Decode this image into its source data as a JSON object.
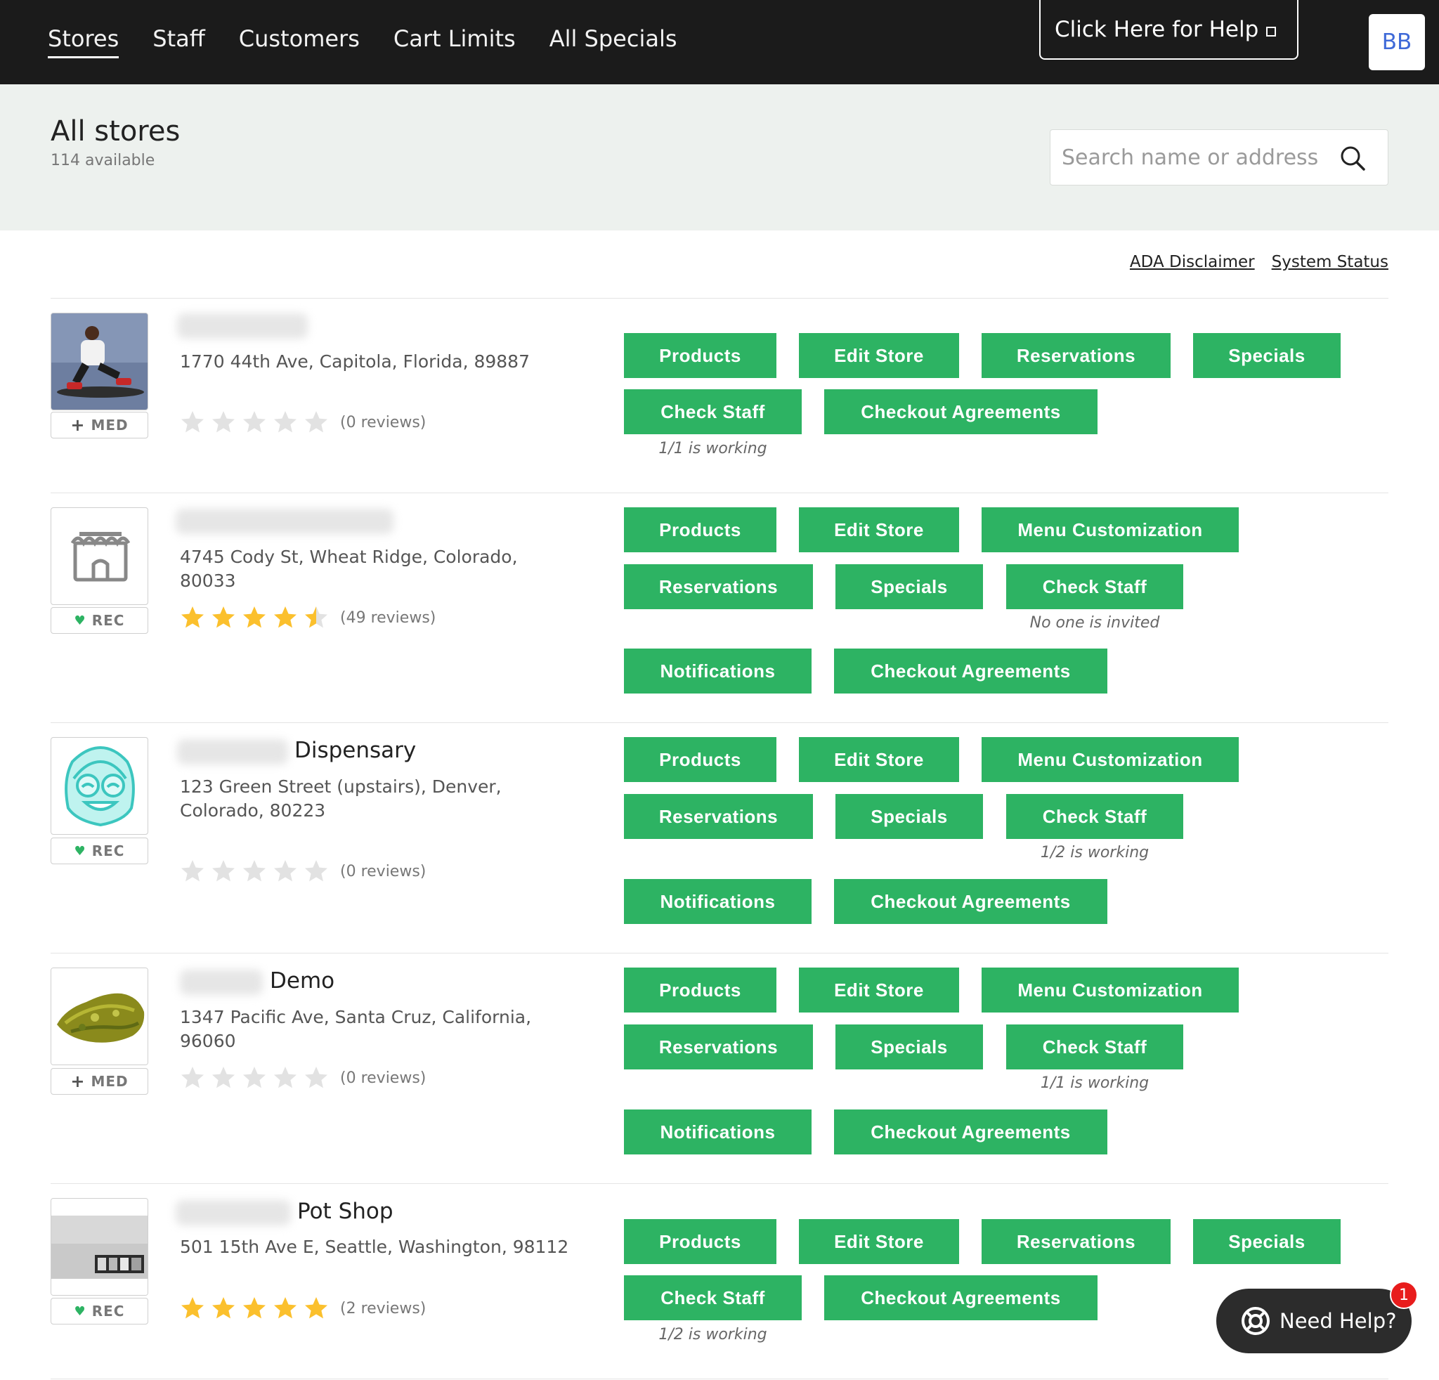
{
  "nav": {
    "items": [
      "Stores",
      "Staff",
      "Customers",
      "Cart Limits",
      "All Specials"
    ],
    "help_label": "Click Here for Help",
    "avatar_initials": "BB"
  },
  "header": {
    "title": "All stores",
    "subtitle": "114 available",
    "search_placeholder": "Search name or address"
  },
  "links": {
    "ada": "ADA Disclaimer",
    "status": "System Status"
  },
  "stores": [
    {
      "name_suffix": "",
      "address": "1770 44th Ave, Capitola, Florida, 89887",
      "tag": "MED",
      "rating": 0,
      "reviews": "(0 reviews)",
      "buttons": [
        "Products",
        "Edit Store",
        "Reservations",
        "Specials",
        "Check Staff",
        "Checkout Agreements"
      ],
      "staff_status": "1/1 is working"
    },
    {
      "name_suffix": "",
      "address": "4745 Cody St, Wheat Ridge, Colorado, 80033",
      "tag": "REC",
      "rating": 4.5,
      "reviews": "(49 reviews)",
      "buttons": [
        "Products",
        "Edit Store",
        "Menu Customization",
        "Reservations",
        "Specials",
        "Check Staff",
        "Notifications",
        "Checkout Agreements"
      ],
      "staff_status": "No one is invited"
    },
    {
      "name_suffix": "Dispensary",
      "address": "123 Green Street (upstairs), Denver, Colorado, 80223",
      "tag": "REC",
      "rating": 0,
      "reviews": "(0 reviews)",
      "buttons": [
        "Products",
        "Edit Store",
        "Menu Customization",
        "Reservations",
        "Specials",
        "Check Staff",
        "Notifications",
        "Checkout Agreements"
      ],
      "staff_status": "1/2 is working"
    },
    {
      "name_suffix": "Demo",
      "address": "1347 Pacific Ave, Santa Cruz, California, 96060",
      "tag": "MED",
      "rating": 0,
      "reviews": "(0 reviews)",
      "buttons": [
        "Products",
        "Edit Store",
        "Menu Customization",
        "Reservations",
        "Specials",
        "Check Staff",
        "Notifications",
        "Checkout Agreements"
      ],
      "staff_status": "1/1 is working"
    },
    {
      "name_suffix": "Pot Shop",
      "address": "501 15th Ave E, Seattle, Washington, 98112",
      "tag": "REC",
      "rating": 5,
      "reviews": "(2 reviews)",
      "buttons": [
        "Products",
        "Edit Store",
        "Reservations",
        "Specials",
        "Check Staff",
        "Checkout Agreements"
      ],
      "staff_status": "1/2 is working"
    }
  ],
  "widget": {
    "label": "Need Help?",
    "badge": "1"
  },
  "colors": {
    "accent_green": "#2db363",
    "nav_bg": "#1b1b1b",
    "band_bg": "#edf1ee",
    "star_gold": "#fbc02d",
    "star_empty": "#e2e2e2"
  }
}
